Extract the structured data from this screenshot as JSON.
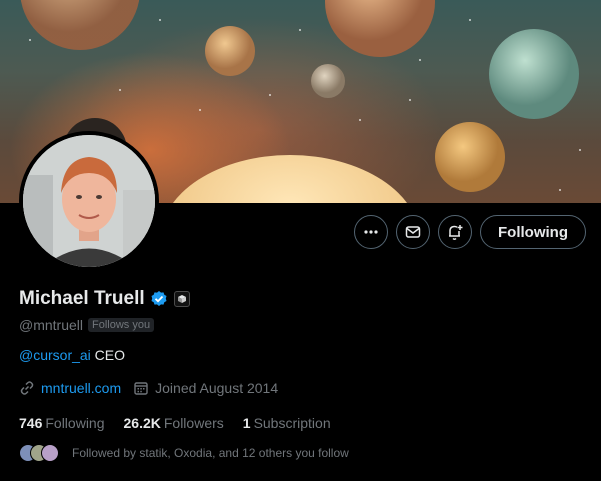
{
  "profile": {
    "name": "Michael Truell",
    "handle": "@mntruell",
    "follows_you": "Follows you",
    "bio_mention": "@cursor_ai",
    "bio_text": " CEO",
    "website": "mntruell.com",
    "joined": "Joined August 2014",
    "verified_color": "#1d9bf0"
  },
  "stats": {
    "following_count": "746",
    "following_label": "Following",
    "followers_count": "26.2K",
    "followers_label": "Followers",
    "subscription_count": "1",
    "subscription_label": "Subscription"
  },
  "actions": {
    "follow_label": "Following",
    "more_icon": "more-icon",
    "message_icon": "mail-icon",
    "notify_icon": "bell-plus-icon"
  },
  "followed_by": {
    "text": "Followed by statik, Oxodia, and 12 others you follow"
  }
}
